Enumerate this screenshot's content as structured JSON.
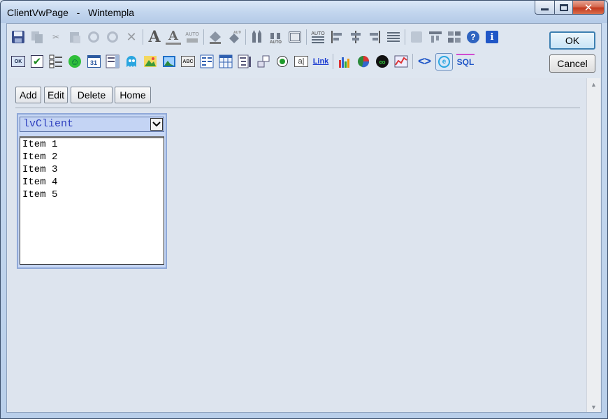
{
  "window": {
    "title": "ClientVwPage   -   Wintempla",
    "minimize": "minimize",
    "maximize": "maximize",
    "close": "✕"
  },
  "dialog": {
    "ok_label": "OK",
    "cancel_label": "Cancel"
  },
  "toolbar": {
    "icons_row1": [
      "save-icon",
      "copy-icon",
      "cut-icon",
      "paste-icon",
      "undo-icon",
      "redo-icon",
      "delete-icon",
      "font-icon",
      "font-color-icon",
      "font-auto-icon",
      "fill-color-icon",
      "fill-auto-icon",
      "pen-icon",
      "pen-auto-icon",
      "border-icon",
      "align-auto-icon",
      "align-left-icon",
      "align-center-icon",
      "align-right-icon",
      "justify-icon",
      "grid-icon",
      "layout-top-icon",
      "layout-icon",
      "help-icon",
      "info-icon"
    ],
    "icons_row2": [
      "button-ok-icon",
      "checkbox-icon",
      "checklist-icon",
      "smiley-icon",
      "calendar-icon",
      "listbox-icon",
      "ghost-icon",
      "picture-icon",
      "image-icon",
      "text-abc-icon",
      "list-view-icon",
      "table-icon",
      "tree-icon",
      "drag-icon",
      "radio-icon",
      "label-icon",
      "link-icon",
      "bar-chart-icon",
      "pie-chart-icon",
      "infinity-icon",
      "line-chart-icon",
      "code-icon",
      "web-browser-icon",
      "sql-icon"
    ],
    "auto_text": "AUTO",
    "abc_text": "ABC",
    "link_text": "Link",
    "sql_text": "SQL",
    "calendar_text": "31"
  },
  "form": {
    "buttons": [
      {
        "label": "Add"
      },
      {
        "label": "Edit"
      },
      {
        "label": "Delete"
      },
      {
        "label": "Home"
      }
    ]
  },
  "listview": {
    "name": "lvClient",
    "items": [
      "Item 1",
      "Item 2",
      "Item 3",
      "Item 4",
      "Item 5"
    ]
  },
  "colors": {
    "accent": "#3c7fb1",
    "listview_title": "#2e3fbf",
    "panel_border": "#8fa8d8"
  }
}
